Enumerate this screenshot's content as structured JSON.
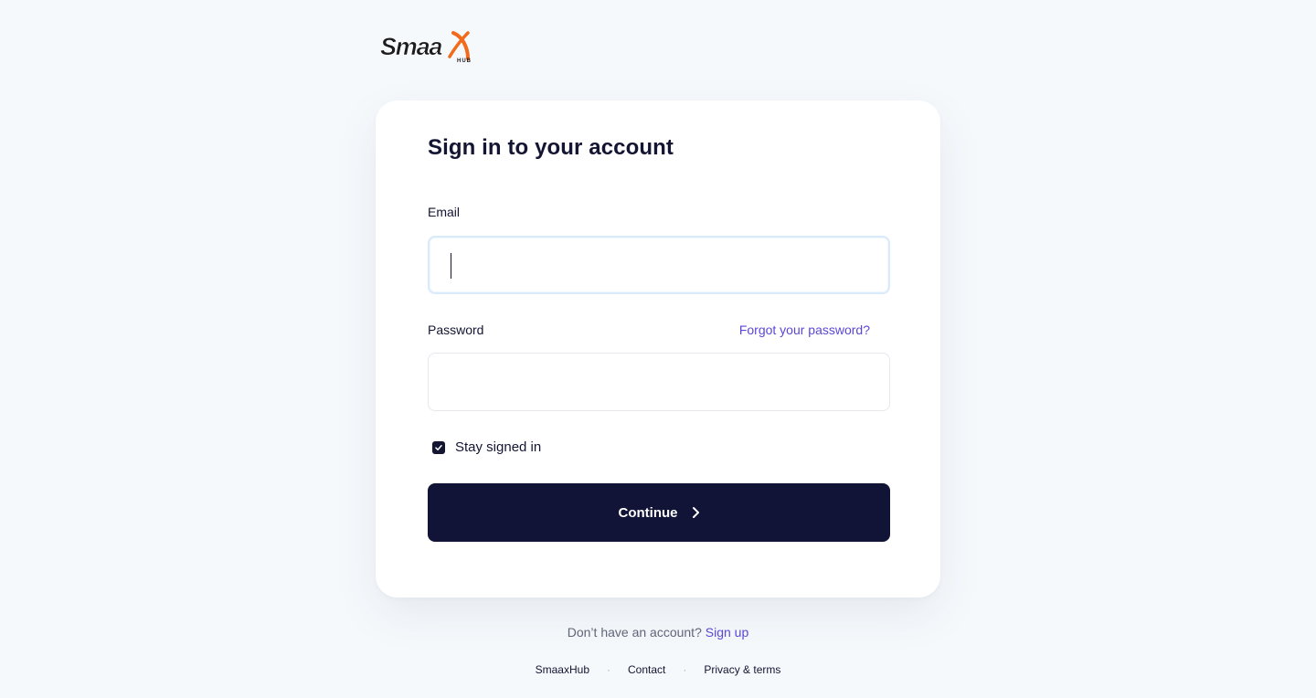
{
  "brand": {
    "logo_text": "Smaax",
    "logo_subtext": "HUB",
    "colors": {
      "navy": "#131532",
      "accent_orange": "#f26a1b",
      "link_purple": "#5b47d6",
      "background": "#f6f9fc"
    }
  },
  "form": {
    "title": "Sign in to your account",
    "email_label": "Email",
    "email_value": "",
    "password_label": "Password",
    "password_value": "",
    "forgot_link": "Forgot your password?",
    "stay_signed_in_label": "Stay signed in",
    "stay_signed_in_checked": true,
    "continue_label": "Continue",
    "continue_icon": "chevron-right-icon",
    "checkbox_icon": "checkmark-icon"
  },
  "signup": {
    "prompt": "Don’t have an account?",
    "link": "Sign up"
  },
  "footer": {
    "links": [
      "SmaaxHub",
      "Contact",
      "Privacy & terms"
    ],
    "separator": "·"
  }
}
